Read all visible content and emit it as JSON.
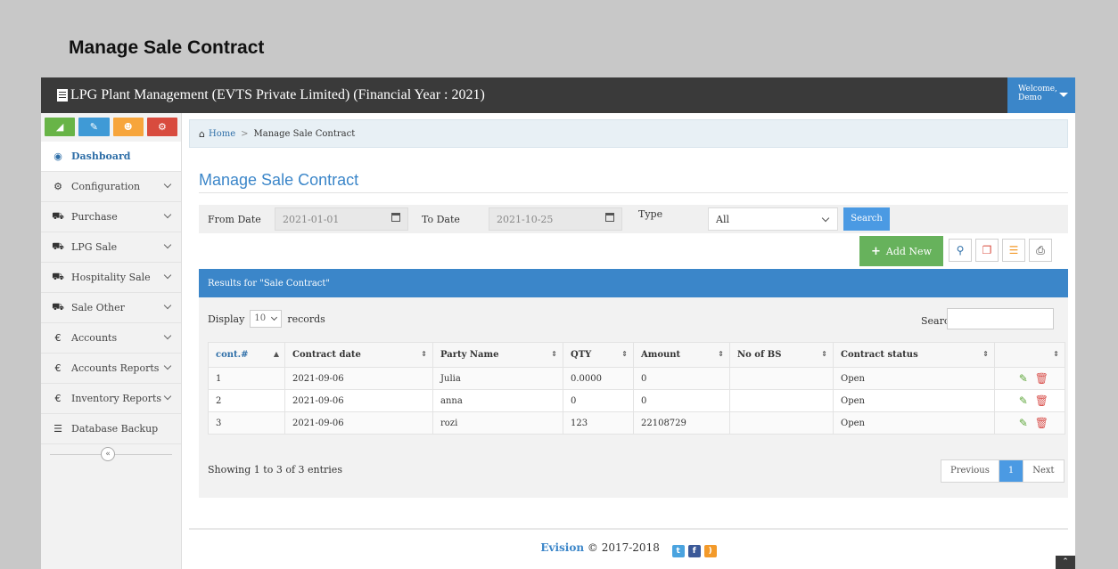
{
  "page_heading": "Manage Sale Contract",
  "topbar": {
    "brand": "LPG Plant Management (EVTS Private Limited) (Financial Year : 2021)",
    "welcome_line1": "Welcome,",
    "welcome_line2": "Demo"
  },
  "sidebar": {
    "items": [
      {
        "label": "Dashboard",
        "icon": "dashboard-icon"
      },
      {
        "label": "Configuration",
        "icon": "cogs-icon"
      },
      {
        "label": "Purchase",
        "icon": "cart-icon"
      },
      {
        "label": "LPG Sale",
        "icon": "cart-icon"
      },
      {
        "label": "Hospitality Sale",
        "icon": "cart-icon"
      },
      {
        "label": "Sale Other",
        "icon": "cart-icon"
      },
      {
        "label": "Accounts",
        "icon": "euro-icon"
      },
      {
        "label": "Accounts Reports",
        "icon": "euro-icon"
      },
      {
        "label": "Inventory Reports",
        "icon": "euro-icon"
      },
      {
        "label": "Database Backup",
        "icon": "database-icon"
      }
    ],
    "collapse_glyph": "«",
    "shortcut_colors": [
      "#68b447",
      "#3f9ad6",
      "#f7a53b",
      "#d84b3e"
    ]
  },
  "breadcrumb": {
    "home": "Home",
    "sep": ">",
    "current": "Manage Sale Contract"
  },
  "section_title": "Manage Sale Contract",
  "filters": {
    "from_label": "From Date",
    "from_value": "2021-01-01",
    "to_label": "To Date",
    "to_value": "2021-10-25",
    "type_label": "Type",
    "type_value": "All",
    "search_button": "Search"
  },
  "toolbar": {
    "add_new": "Add New"
  },
  "results": {
    "header": "Results for \"Sale Contract\"",
    "display_label": "Display",
    "page_length": "10",
    "records_label": "records",
    "search_label": "Search:",
    "columns": [
      "cont.#",
      "Contract date",
      "Party Name",
      "QTY",
      "Amount",
      "No of BS",
      "Contract status",
      ""
    ],
    "rows": [
      [
        "1",
        "2021-09-06",
        "Julia",
        "0.0000",
        "0",
        "",
        "Open"
      ],
      [
        "2",
        "2021-09-06",
        "anna",
        "0",
        "0",
        "",
        "Open"
      ],
      [
        "3",
        "2021-09-06",
        "rozi",
        "123",
        "22108729",
        "",
        "Open"
      ]
    ],
    "info": "Showing 1 to 3 of 3 entries",
    "pager": {
      "previous": "Previous",
      "current": "1",
      "next": "Next"
    }
  },
  "footer": {
    "brand": "Evision",
    "copyright": "© 2017-2018"
  },
  "colors": {
    "accent": "#3b86c9",
    "topbar": "#3a3a3a",
    "add_new": "#67b25c",
    "edit": "#5ea63a",
    "delete": "#d9534f"
  }
}
